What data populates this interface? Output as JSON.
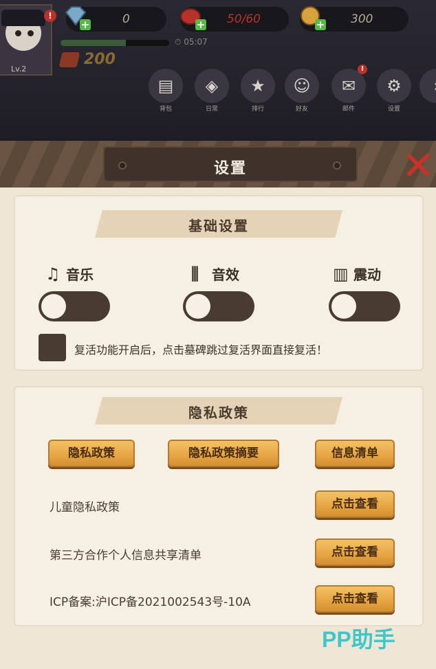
{
  "hud": {
    "level": "Lv.2",
    "avatar_badge": "!",
    "resources": [
      {
        "name": "gem",
        "value": "0",
        "color": "#7aa8c8"
      },
      {
        "name": "stamina",
        "value": "50/60",
        "color": "#b8322c"
      },
      {
        "name": "coin",
        "value": "300",
        "color": "#d8a23c"
      }
    ],
    "exp_progress": 0.6,
    "timer": "05:07",
    "power": "200",
    "menu": [
      {
        "icon": "backpack-icon",
        "label": "背包"
      },
      {
        "icon": "daily-icon",
        "label": "日常"
      },
      {
        "icon": "ranking-icon",
        "label": "排行"
      },
      {
        "icon": "friends-icon",
        "label": "好友"
      },
      {
        "icon": "mail-icon",
        "label": "邮件",
        "badge": "!"
      },
      {
        "icon": "gear-icon",
        "label": "设置"
      }
    ]
  },
  "panel": {
    "title": "设置",
    "close_glyph": "✕",
    "basic": {
      "heading": "基础设置",
      "toggles": [
        {
          "label": "音乐",
          "icon": "music-icon",
          "on": false
        },
        {
          "label": "音效",
          "icon": "sound-effects-icon",
          "on": false
        },
        {
          "label": "震动",
          "icon": "vibration-icon",
          "on": false
        }
      ],
      "checkbox_note": "复活功能开启后，点击墓碑跳过复活界面直接复活！"
    },
    "privacy": {
      "heading": "隐私政策",
      "buttons": [
        "隐私政策",
        "隐私政策摘要",
        "信息清单"
      ],
      "rows": [
        {
          "label": "儿童隐私政策",
          "button": "点击查看"
        },
        {
          "label": "第三方合作个人信息共享清单",
          "button": "点击查看"
        },
        {
          "label": "ICP备案:沪ICP备2021002543号-10A",
          "button": "点击查看"
        }
      ]
    }
  },
  "watermark": "PP助手",
  "colors": {
    "accent_gold": "#e5a341",
    "toggle_off": "#4a3b31",
    "panel_bg": "#efe6d6"
  }
}
